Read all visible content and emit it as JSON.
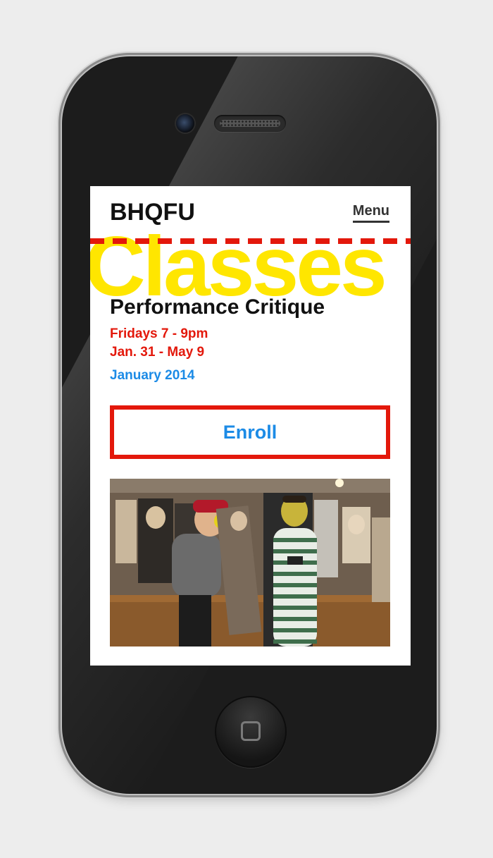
{
  "site": {
    "logo": "BHQFU",
    "menu_label": "Menu"
  },
  "hero": {
    "section_word": "Classes"
  },
  "class": {
    "title": "Performance Critique",
    "schedule_day_time": "Fridays 7 - 9pm",
    "schedule_dates": "Jan. 31 - May 9",
    "term": "January 2014",
    "enroll_label": "Enroll"
  },
  "photo": {
    "icon": "performance-photo"
  },
  "colors": {
    "accent_red": "#e3180b",
    "accent_yellow": "#ffe600",
    "accent_blue": "#1c8be6",
    "phone_body": "#1c1c1c"
  }
}
